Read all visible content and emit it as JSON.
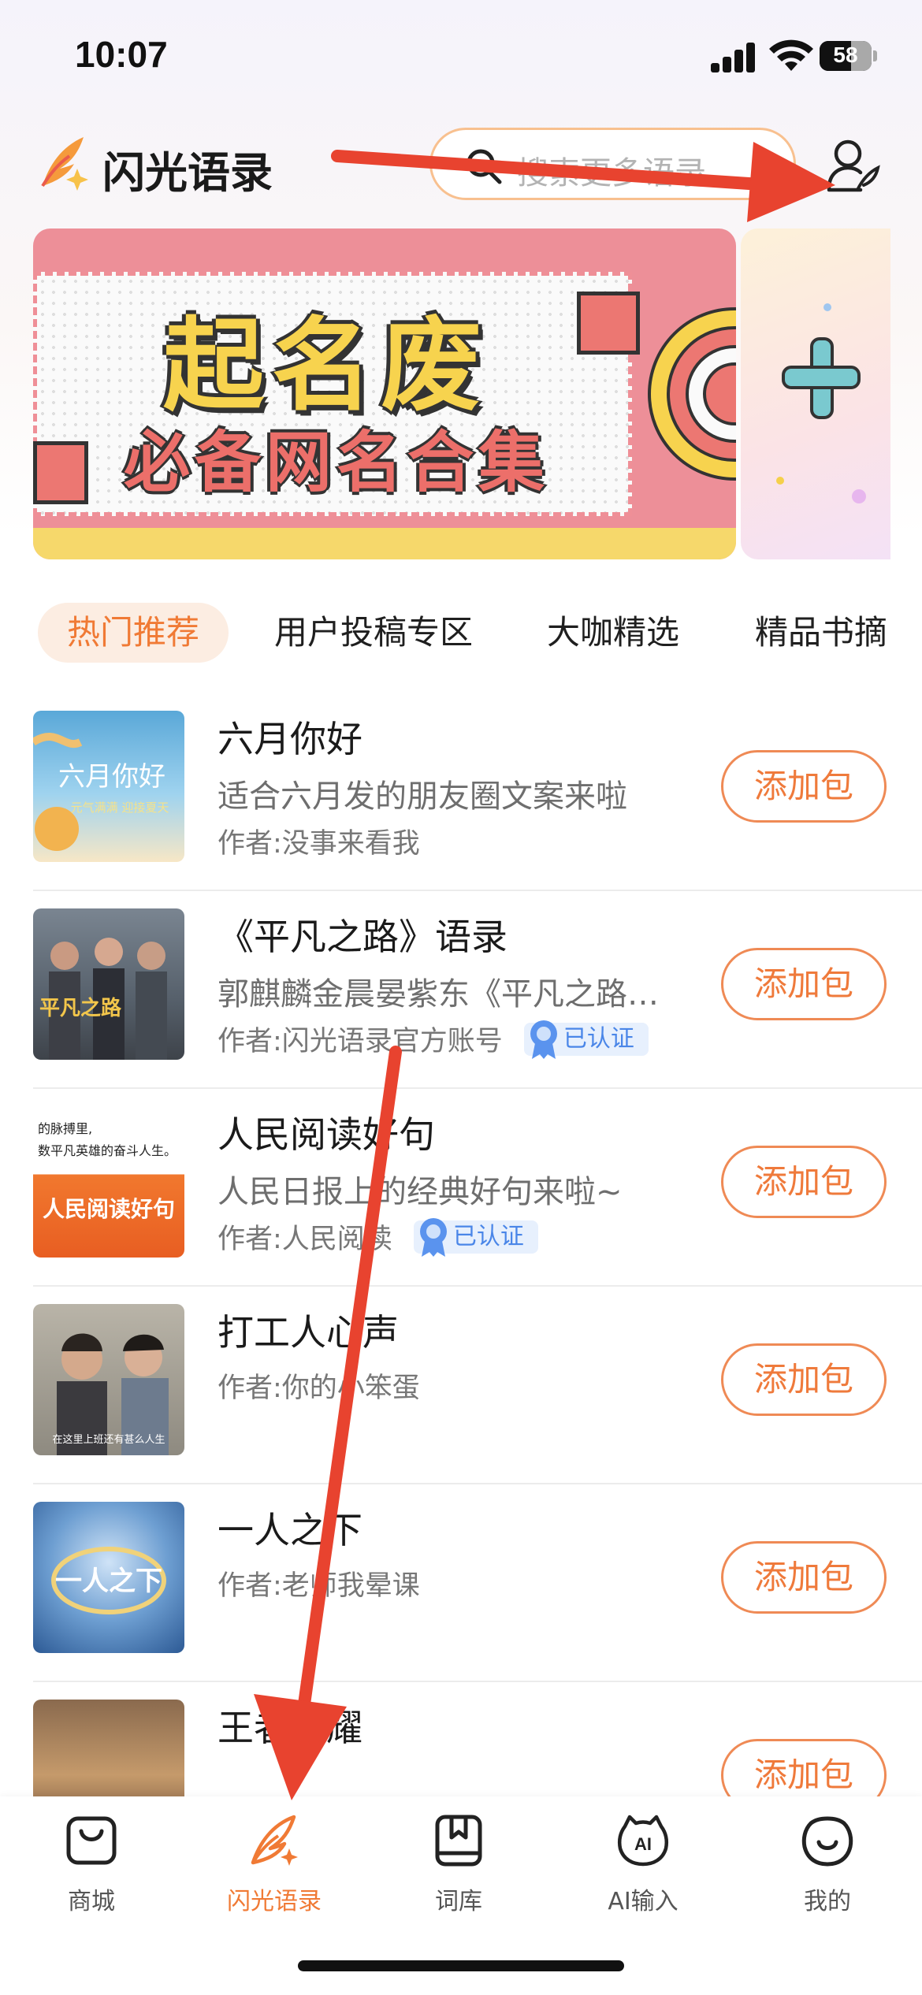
{
  "status_bar": {
    "time": "10:07",
    "battery": "58"
  },
  "header": {
    "app_title": "闪光语录",
    "search_placeholder": "搜索更多语录"
  },
  "banner": {
    "title": "起名废",
    "subtitle": "必备网名合集"
  },
  "tabs": [
    {
      "label": "热门推荐",
      "active": true
    },
    {
      "label": "用户投稿专区",
      "active": false
    },
    {
      "label": "大咖精选",
      "active": false
    },
    {
      "label": "精品书摘",
      "active": false
    }
  ],
  "list": [
    {
      "title": "六月你好",
      "desc": "适合六月发的朋友圈文案来啦",
      "author": "作者:没事来看我",
      "verified": false,
      "button": "添加包",
      "thumb_text": "六月你好",
      "thumb_sub": "元气满满 迎接夏天"
    },
    {
      "title": "《平凡之路》语录",
      "desc": "郭麒麟金晨晏紫东《平凡之路》语录",
      "author": "作者:闪光语录官方账号",
      "verified": true,
      "verified_label": "已认证",
      "button": "添加包",
      "thumb_text": "平凡之路"
    },
    {
      "title": "人民阅读好句",
      "desc": "人民日报上的经典好句来啦~",
      "author": "作者:人民阅读",
      "verified": true,
      "verified_label": "已认证",
      "button": "添加包",
      "thumb_text": "人民阅读好句",
      "thumb_sub": "的脉搏里,\n数平凡英雄的奋斗人生。"
    },
    {
      "title": "打工人心声",
      "desc": "",
      "author": "作者:你的小笨蛋",
      "verified": false,
      "button": "添加包",
      "thumb_sub": "在这里上班还有甚么人生"
    },
    {
      "title": "一人之下",
      "desc": "",
      "author": "作者:老师我晕课",
      "verified": false,
      "button": "添加包",
      "thumb_text": "一人之下"
    },
    {
      "title": "王者荣耀",
      "desc": "",
      "author": "",
      "verified": false,
      "button": "添加包"
    }
  ],
  "bottom_nav": [
    {
      "label": "商城",
      "icon": "shop-bag-icon",
      "active": false
    },
    {
      "label": "闪光语录",
      "icon": "quill-sparkle-icon",
      "active": true
    },
    {
      "label": "词库",
      "icon": "bookmark-book-icon",
      "active": false
    },
    {
      "label": "AI输入",
      "icon": "ai-face-icon",
      "active": false
    },
    {
      "label": "我的",
      "icon": "smile-face-icon",
      "active": false
    }
  ],
  "colors": {
    "accent": "#f07a35",
    "annotation_arrow": "#e8432f",
    "verified_blue": "#4a86e8"
  }
}
